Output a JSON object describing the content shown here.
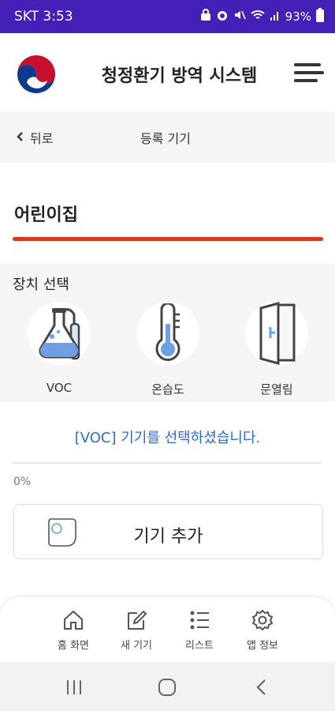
{
  "status": {
    "carrier_time": "SKT 3:53",
    "battery": "93%"
  },
  "app": {
    "title": "청정환기 방역 시스템"
  },
  "subbar": {
    "back_label": "뒤로",
    "title": "등록 기기"
  },
  "section": {
    "title": "어린이집"
  },
  "device_select": {
    "label": "장치 선택",
    "devices": [
      {
        "label": "VOC",
        "icon": "flask-icon"
      },
      {
        "label": "온습도",
        "icon": "thermometer-icon"
      },
      {
        "label": "문열림",
        "icon": "door-icon"
      }
    ]
  },
  "selection_message": "[VOC] 기기를 선택하셨습니다.",
  "progress": {
    "text": "0%",
    "value": 0
  },
  "add_device": {
    "label": "기기 추가",
    "icon": "sensor-icon"
  },
  "bottom_nav": [
    {
      "label": "홈 화면",
      "icon": "home-icon"
    },
    {
      "label": "새 기기",
      "icon": "edit-icon"
    },
    {
      "label": "리스트",
      "icon": "list-icon"
    },
    {
      "label": "앱 정보",
      "icon": "gear-icon"
    }
  ],
  "colors": {
    "status_bar": "#4420b8",
    "accent_red": "#d8381e",
    "message_blue": "#2a6cd0"
  }
}
